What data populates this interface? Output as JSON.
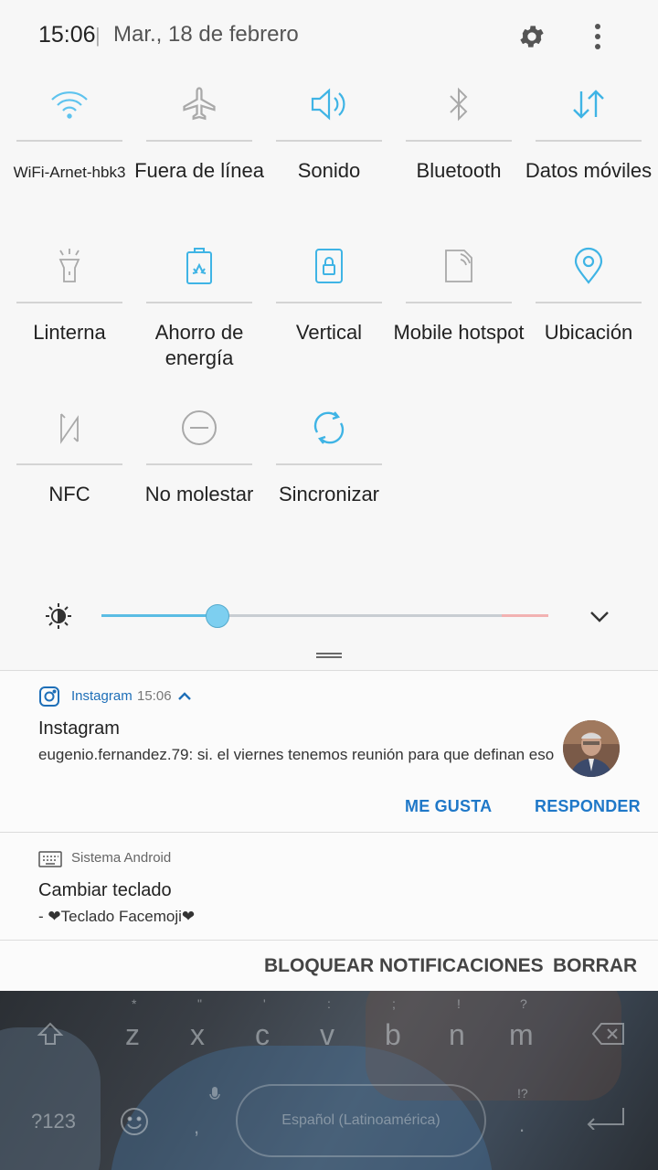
{
  "status": {
    "time": "15:06",
    "separator": "|",
    "date": "Mar., 18 de febrero"
  },
  "header_icons": [
    "gear-icon",
    "more-vert-icon"
  ],
  "quick_settings": [
    {
      "label": "WiFi-Arnet-hbk3",
      "icon": "wifi-icon",
      "active": true
    },
    {
      "label": "Fuera de línea",
      "icon": "airplane-icon",
      "active": false
    },
    {
      "label": "Sonido",
      "icon": "speaker-icon",
      "active": true
    },
    {
      "label": "Bluetooth",
      "icon": "bluetooth-icon",
      "active": false
    },
    {
      "label": "Datos móviles",
      "icon": "data-arrows-icon",
      "active": true
    },
    {
      "label": "Linterna",
      "icon": "flashlight-icon",
      "active": false
    },
    {
      "label": "Ahorro de energía",
      "icon": "battery-saver-icon",
      "active": true
    },
    {
      "label": "Vertical",
      "icon": "rotation-lock-icon",
      "active": true
    },
    {
      "label": "Mobile hotspot",
      "icon": "hotspot-icon",
      "active": false
    },
    {
      "label": "Ubicación",
      "icon": "location-pin-icon",
      "active": true
    },
    {
      "label": "NFC",
      "icon": "nfc-icon",
      "active": false
    },
    {
      "label": "No molestar",
      "icon": "do-not-disturb-icon",
      "active": false
    },
    {
      "label": "Sincronizar",
      "icon": "sync-icon",
      "active": true
    }
  ],
  "brightness": {
    "level": 0.26
  },
  "notifications": [
    {
      "app": "Instagram",
      "time": "15:06",
      "title": "Instagram",
      "text": "eugenio.fernandez.79: si. el viernes tenemos reunión para que definan eso",
      "actions": [
        "ME GUSTA",
        "RESPONDER"
      ]
    },
    {
      "app": "Sistema Android",
      "title": "Cambiar teclado",
      "text": " - ❤Teclado Facemoji❤"
    }
  ],
  "bottom_actions": {
    "block": "BLOQUEAR NOTIFICACIONES",
    "clear": "BORRAR"
  },
  "keyboard": {
    "row_letters": [
      "z",
      "x",
      "c",
      "v",
      "b",
      "n",
      "m"
    ],
    "row_symbols": [
      "*",
      "\"",
      "'",
      ":",
      ";",
      "!",
      "?"
    ],
    "numeric_key": "?123",
    "comma": ",",
    "period": ".",
    "punct_key": "!?",
    "space_label": "Español (Latinoamérica)"
  },
  "colors": {
    "accent": "#3fb4e5",
    "inactive_icon": "#a9a9a9",
    "action_blue": "#1f78c8"
  }
}
